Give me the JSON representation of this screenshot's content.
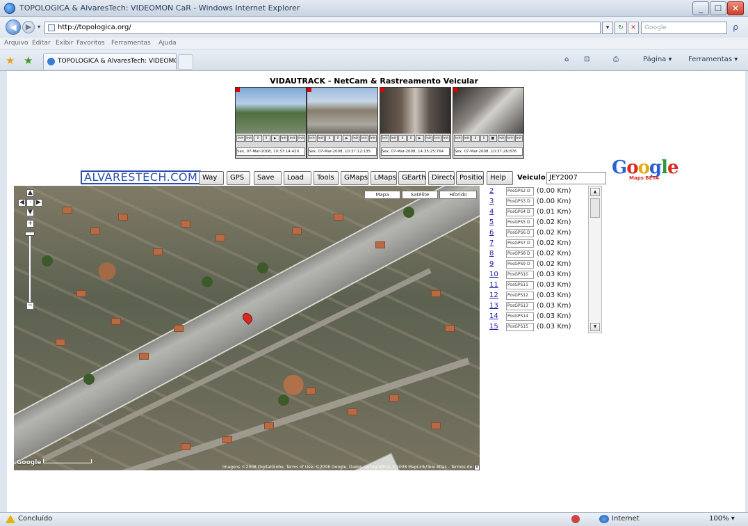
{
  "window": {
    "title": "TOPOLOGICA & AlvaresTech: VIDEOMON CaR - Windows Internet Explorer",
    "minimize": "_",
    "maximize": "☐",
    "close": "✕"
  },
  "nav": {
    "back": "◀",
    "forward": "▶",
    "dropdown": "▾",
    "url": "http://topologica.org/",
    "refresh": "↻",
    "stop": "✕",
    "go": "▾",
    "search_placeholder": "Google",
    "search_go": "ρ"
  },
  "menu": [
    "Arquivo",
    "Editar",
    "Exibir",
    "Favoritos",
    "Ferramentas",
    "Ajuda"
  ],
  "tab": {
    "label": "TOPOLOGICA & AlvaresTech: VIDEOMOR ...",
    "favorites_star": "★",
    "add_favorites": "★"
  },
  "toolbar": {
    "home": "⌂",
    "feeds": "⊡",
    "print": "⎙",
    "page": "Página ▾",
    "tools": "Ferramentas ▾"
  },
  "page": {
    "heading": "VIDAUTRACK - NetCam & Rastreamento Veicular",
    "cams": [
      {
        "timestamp": "Sex, 07-Mar-2008, 10:37:14:420",
        "controls": [
          "Init",
          "Init",
          "Ⅱ",
          "Ⅱ",
          "▶",
          "Init",
          "Init",
          "Init"
        ]
      },
      {
        "timestamp": "Sex, 07-Mar-2008, 10:37:12:135",
        "controls": [
          "Init",
          "Init",
          "Ⅱ",
          "Ⅱ",
          "▶",
          "Init",
          "Init",
          "Init"
        ]
      },
      {
        "timestamp": "Sex, 07-Mar-2008, 14:35:25:764",
        "controls": [
          "Init",
          "Init",
          "Ⅱ",
          "Ⅱ",
          "▶",
          "Init",
          "Init",
          "Init"
        ]
      },
      {
        "timestamp": "Sex, 07-Mar-2008, 10:37:26:876",
        "controls": [
          "Init",
          "Init",
          "Ⅱ",
          "Ⅱ",
          "■",
          "Init",
          "Init",
          "Init"
        ]
      }
    ],
    "brand": "ALVARESTECH.COM",
    "buttons": [
      "Way",
      "GPS",
      "Save",
      "Load",
      "Tools",
      "GMaps",
      "LMaps",
      "GEarth",
      "Directc",
      "Positior",
      "Help"
    ],
    "vehicle_label": "Veiculo",
    "vehicle_value": "JEY2007",
    "google_logo": [
      "G",
      "o",
      "o",
      "g",
      "l",
      "e"
    ],
    "google_sub": "Maps BETA",
    "map_types": [
      "Mapa",
      "Satélite",
      "Híbrido"
    ],
    "map_controls": {
      "up": "▲",
      "left": "◀",
      "right": "▶",
      "down": "▼",
      "center": "·",
      "zoom_in": "+",
      "zoom_out": "−",
      "close": "x"
    },
    "map_footer": "Google",
    "map_copyright": "Imagens ©2008 DigitalGlobe, Terms of Use, ©2008 Google, Dados cartográficos ©2008 MapLink/Tele Atlas - Termos de Uso",
    "positions": [
      {
        "num": "2",
        "label": "PosGPS2 D",
        "dist": "(0.00 Km)"
      },
      {
        "num": "3",
        "label": "PosGPS3 D",
        "dist": "(0.00 Km)"
      },
      {
        "num": "4",
        "label": "PosGPS4 D",
        "dist": "(0.01 Km)"
      },
      {
        "num": "5",
        "label": "PosGPS5 D",
        "dist": "(0.02 Km)"
      },
      {
        "num": "6",
        "label": "PosGPS6 D",
        "dist": "(0.02 Km)"
      },
      {
        "num": "7",
        "label": "PosGPS7 D",
        "dist": "(0.02 Km)"
      },
      {
        "num": "8",
        "label": "PosGPS8 D",
        "dist": "(0.02 Km)"
      },
      {
        "num": "9",
        "label": "PosGPS9 D",
        "dist": "(0.02 Km)"
      },
      {
        "num": "10",
        "label": "PosGPS10",
        "dist": "(0.03 Km)"
      },
      {
        "num": "11",
        "label": "PosGPS11",
        "dist": "(0.03 Km)"
      },
      {
        "num": "12",
        "label": "PosGPS12",
        "dist": "(0.03 Km)"
      },
      {
        "num": "13",
        "label": "PosGPS13",
        "dist": "(0.03 Km)"
      },
      {
        "num": "14",
        "label": "PosGPS14",
        "dist": "(0.03 Km)"
      },
      {
        "num": "15",
        "label": "PosGPS15",
        "dist": "(0.03 Km)"
      }
    ],
    "scroll_up": "▲",
    "scroll_down": "▼"
  },
  "status": {
    "text": "Concluído",
    "zone": "Internet",
    "zoom": "100% ▾"
  }
}
